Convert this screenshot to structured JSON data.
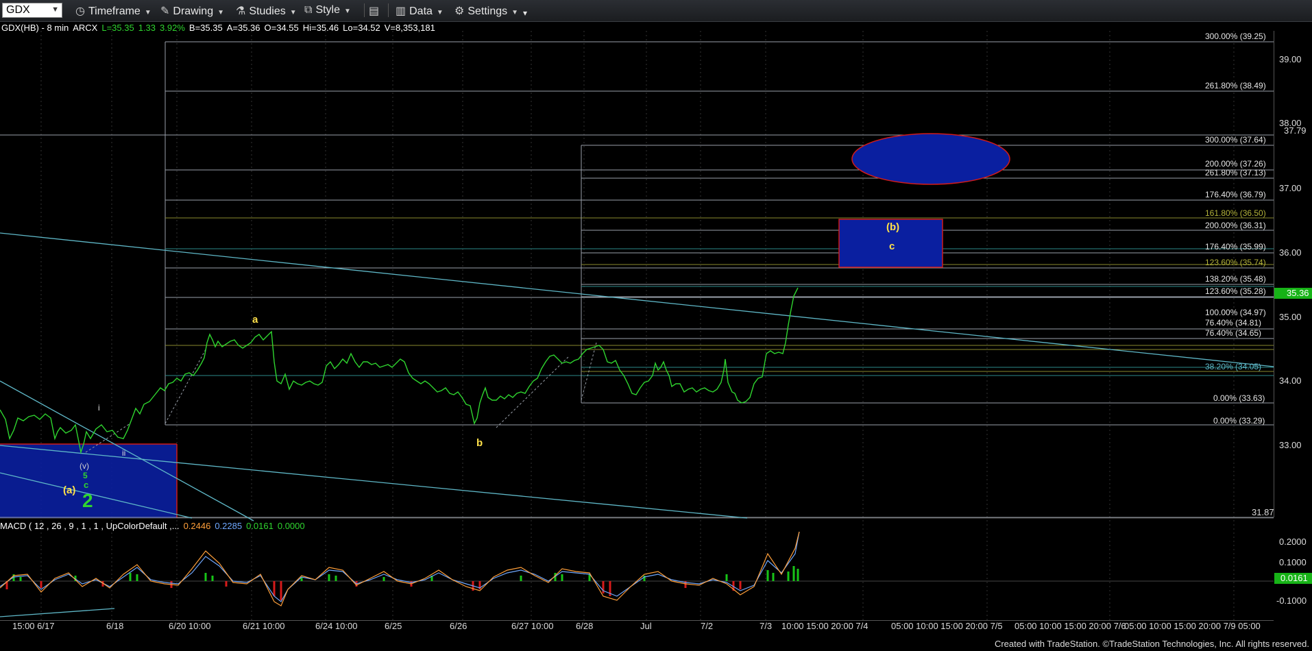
{
  "toolbar": {
    "symbol": "GDX",
    "timeframe": "Timeframe",
    "drawing": "Drawing",
    "studies": "Studies",
    "style": "Style",
    "data": "Data",
    "settings": "Settings"
  },
  "info": {
    "symbol": "GDX(HB) - 8 min",
    "exchange": "ARCX",
    "last": "L=35.35",
    "change": "1.33",
    "pct": "3.92%",
    "bid": "B=35.35",
    "ask": "A=35.36",
    "open": "O=34.55",
    "high": "Hi=35.46",
    "low": "Lo=34.52",
    "volume": "V=8,353,181"
  },
  "price_axis": [
    "39.00",
    "38.00",
    "37.79",
    "37.00",
    "36.00",
    "35.00",
    "34.00",
    "33.00",
    "31.87"
  ],
  "last_price": "35.36",
  "fib_labels": {
    "f300a": "300.00% (39.25)",
    "f2618a": "261.80% (38.49)",
    "f300b": "300.00% (37.64)",
    "f200a": "200.00% (37.26)",
    "f2618b": "261.80% (37.13)",
    "f1764a": "176.40% (36.79)",
    "f1618": "161.80% (36.50)",
    "f200b": "200.00% (36.31)",
    "f1764b": "176.40% (35.99)",
    "f1236": "123.60% (35.74)",
    "f1382": "138.20% (35.48)",
    "f1236b": "123.60% (35.28)",
    "f100": "100.00% (34.97)",
    "f764a": "76.40% (34.81)",
    "f764b": "76.40% (34.65)",
    "f382": "38.20% (34.05)",
    "f0a": "0.00% (33.63)",
    "f0b": "0.00% (33.29)"
  },
  "waves": {
    "a": "a",
    "b": "b",
    "b_paren": "(b)",
    "c": "c",
    "i": "i",
    "ii": "ii",
    "v_paren": "(v)",
    "five": "5",
    "c_green": "c",
    "a_paren": "(a)",
    "two": "2"
  },
  "macd": {
    "title": "MACD ( 12 , 26 , 9 , 1 , 1 , UpColorDefault ,...",
    "v1": "0.2446",
    "v2": "0.2285",
    "v3": "0.0161",
    "v4": "0.0000",
    "axis": [
      "0.2000",
      "0.1000",
      "-0.1000"
    ],
    "tag": "0.0161"
  },
  "time_axis": [
    "15:00 6/17",
    "6/18",
    "6/20 10:00",
    "6/21 10:00",
    "6/24 10:00",
    "6/25",
    "6/26",
    "6/27 10:00",
    "6/28",
    "Jul",
    "7/2",
    "7/3",
    "10:00 15:00 20:00 7/4",
    "05:00 10:00 15:00 20:00 7/5",
    "05:00 10:00 15:00 20:00 7/6",
    "05:00 10:00 15:00 20:00 7/9 05:00"
  ],
  "footer": "Created with TradeStation. ©TradeStation Technologies, Inc. All rights reserved.",
  "colors": {
    "price": "#2fd52f",
    "fib_line": "#9aa0aa",
    "trendline": "#5fb8c8",
    "target_box": "#0a1fa0",
    "ellipse_stroke": "#d01b1b",
    "wave_yellow": "#ffe14a",
    "wave_green": "#2fd52f",
    "macd_fast": "#ff9f3a",
    "macd_slow": "#6fa8ff",
    "hist_pos": "#17c417",
    "hist_neg": "#d61a1a"
  }
}
